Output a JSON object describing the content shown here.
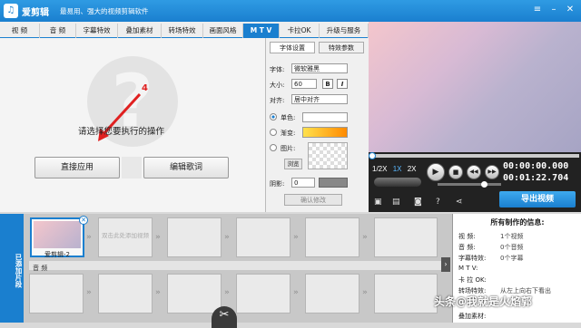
{
  "app": {
    "title": "爱剪辑",
    "slogan": "最易用、强大的视频剪辑软件"
  },
  "tabs": [
    "视 频",
    "音 频",
    "字幕特效",
    "叠加素材",
    "转场特效",
    "画面风格",
    "M T V",
    "卡拉OK",
    "升级与服务"
  ],
  "active_tab": "M T V",
  "editor": {
    "hint": "请选择您要执行的操作",
    "step_number": "4",
    "apply_button": "直接应用",
    "edit_lyrics_button": "编辑歌词"
  },
  "settings": {
    "tabs": [
      "字体设置",
      "特效参数"
    ],
    "font_label": "字体:",
    "font_value": "微软雅黑",
    "size_label": "大小:",
    "size_value": "60",
    "bold": "B",
    "italic": "I",
    "align_label": "对齐:",
    "align_value": "居中对齐",
    "solid_label": "单色:",
    "gradient_label": "渐变:",
    "image_label": "图片:",
    "browse_button": "浏览",
    "shadow_label": "阴影:",
    "shadow_value": "0",
    "confirm_button": "确认修改"
  },
  "player": {
    "speeds": [
      "1/2X",
      "1X",
      "2X"
    ],
    "current_time": "00:00:00.000",
    "total_time": "00:01:22.704",
    "export_button": "导出视频"
  },
  "timeline": {
    "side_label": "已添加片段",
    "clip_label": "爱剪辑-2",
    "add_hint": "双击此处添加视频",
    "audio_label": "音 频"
  },
  "info": {
    "title": "所有制作的信息:",
    "rows": [
      {
        "key": "视 频:",
        "value": "1个视频"
      },
      {
        "key": "音 频:",
        "value": "0个音频"
      },
      {
        "key": "字幕特效:",
        "value": "0个字幕"
      },
      {
        "key": "M T V:",
        "value": ""
      },
      {
        "key": "卡 拉 OK:",
        "value": ""
      },
      {
        "key": "转场特效:",
        "value": "从左上向右下看出"
      },
      {
        "key": "叠加素材:",
        "value": ""
      }
    ]
  },
  "watermark": "头条@我就是火焰郭",
  "colors": {
    "accent": "#1a7fcf",
    "red": "#e02020"
  }
}
